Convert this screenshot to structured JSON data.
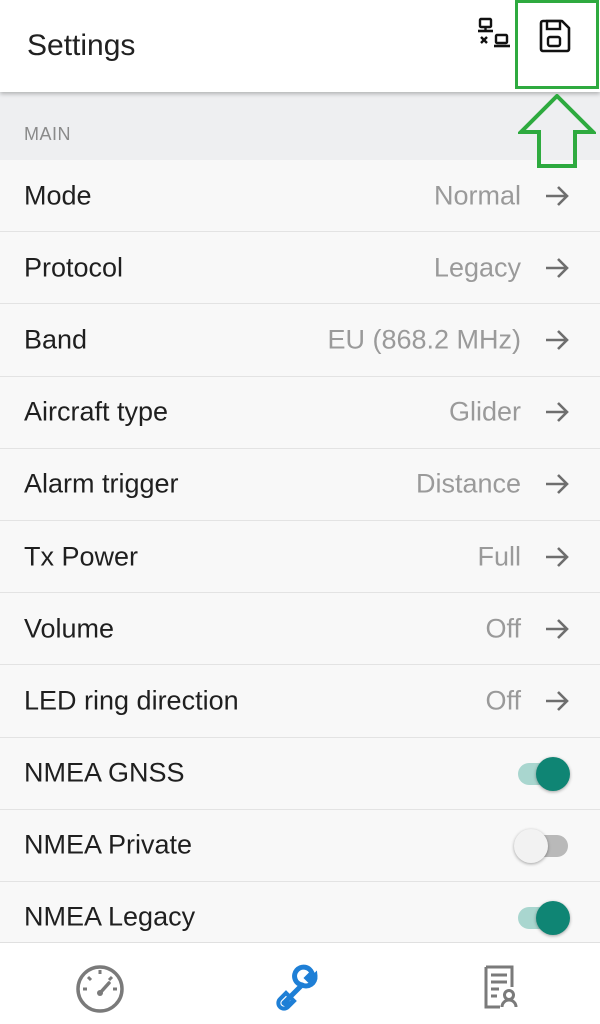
{
  "appbar": {
    "title": "Settings",
    "actions": [
      {
        "name": "network-disconnected-icon"
      },
      {
        "name": "save-icon"
      }
    ]
  },
  "section": {
    "title": "MAIN"
  },
  "settings": [
    {
      "label": "Mode",
      "value": "Normal",
      "type": "nav"
    },
    {
      "label": "Protocol",
      "value": "Legacy",
      "type": "nav"
    },
    {
      "label": "Band",
      "value": "EU (868.2 MHz)",
      "type": "nav"
    },
    {
      "label": "Aircraft type",
      "value": "Glider",
      "type": "nav"
    },
    {
      "label": "Alarm trigger",
      "value": "Distance",
      "type": "nav"
    },
    {
      "label": "Tx Power",
      "value": "Full",
      "type": "nav"
    },
    {
      "label": "Volume",
      "value": "Off",
      "type": "nav"
    },
    {
      "label": "LED ring direction",
      "value": "Off",
      "type": "nav"
    },
    {
      "label": "NMEA GNSS",
      "checked": true,
      "type": "toggle"
    },
    {
      "label": "NMEA Private",
      "checked": false,
      "type": "toggle"
    },
    {
      "label": "NMEA Legacy",
      "checked": true,
      "type": "toggle"
    }
  ],
  "bottom_nav": [
    {
      "name": "speedometer-icon",
      "active": false
    },
    {
      "name": "wrench-icon",
      "active": true
    },
    {
      "name": "log-report-icon",
      "active": false
    }
  ],
  "colors": {
    "accent": "#0f8574",
    "nav_active": "#1e7fd6",
    "nav_inactive": "#7a7a7a",
    "highlight": "#2eaa3f"
  }
}
